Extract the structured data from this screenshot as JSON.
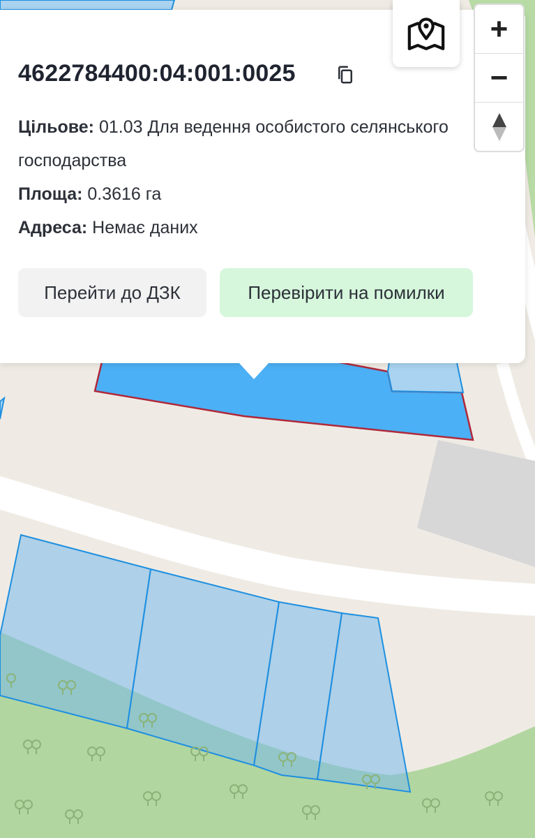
{
  "popup": {
    "cadastral_number": "4622784400:04:001:0025",
    "purpose_label": "Цільове:",
    "purpose_value": "01.03 Для ведення особистого селянського господарства",
    "area_label": "Площа:",
    "area_value": "0.3616 га",
    "address_label": "Адреса:",
    "address_value": "Немає даних",
    "btn_dzk": "Перейти до ДЗК",
    "btn_check": "Перевірити на помилки"
  },
  "controls": {
    "zoom_in": "+",
    "zoom_out": "−"
  },
  "icons": {
    "copy": "copy-icon",
    "map_type": "map-marker-icon",
    "compass": "compass-icon",
    "tree": "tree-icon"
  },
  "colors": {
    "selected_parcel_fill": "#4bb0f5",
    "selected_parcel_stroke": "#b0283a",
    "parcel_fill": "#a9d3f0",
    "parcel_stroke": "#1e8fe0",
    "forest": "#b2d6a0",
    "road": "#ffffff",
    "building": "#d7d7d7",
    "check_button": "#d6f7dc"
  }
}
